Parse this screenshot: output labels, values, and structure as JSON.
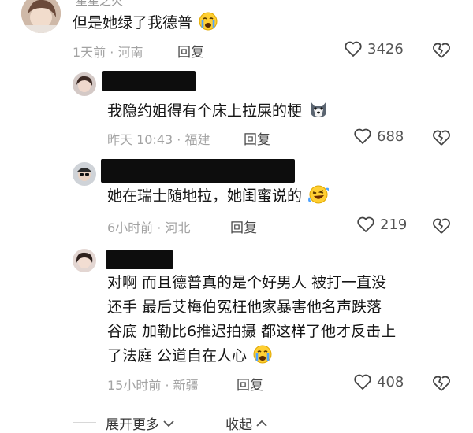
{
  "comments": [
    {
      "username": "星星之火",
      "text": "但是她绿了我德普",
      "time": "1天前",
      "location": "河南",
      "reply_label": "回复",
      "likes": "3426"
    },
    {
      "text": "我隐约姐得有个床上拉屎的梗",
      "time": "昨天 10:43",
      "location": "福建",
      "reply_label": "回复",
      "likes": "688"
    },
    {
      "text": "她在瑞士随地拉，她闺蜜说的",
      "time": "6小时前",
      "location": "河北",
      "reply_label": "回复",
      "likes": "219"
    },
    {
      "text_lines": [
        "对啊 而且德普真的是个好男人 被打一直没",
        "还手 最后艾梅伯冤枉他家暴害他名声跌落",
        "谷底 加勒比6推迟拍摄 都这样了他才反击上",
        "了法庭 公道自在人心"
      ],
      "time": "15小时前",
      "location": "新疆",
      "reply_label": "回复",
      "likes": "408"
    }
  ],
  "footer": {
    "expand_label": "展开更多",
    "collapse_label": "收起"
  },
  "icons": {
    "like": "heart-outline-icon",
    "dislike": "broken-heart-icon",
    "expand": "chevron-down-icon",
    "collapse": "chevron-up-icon"
  }
}
